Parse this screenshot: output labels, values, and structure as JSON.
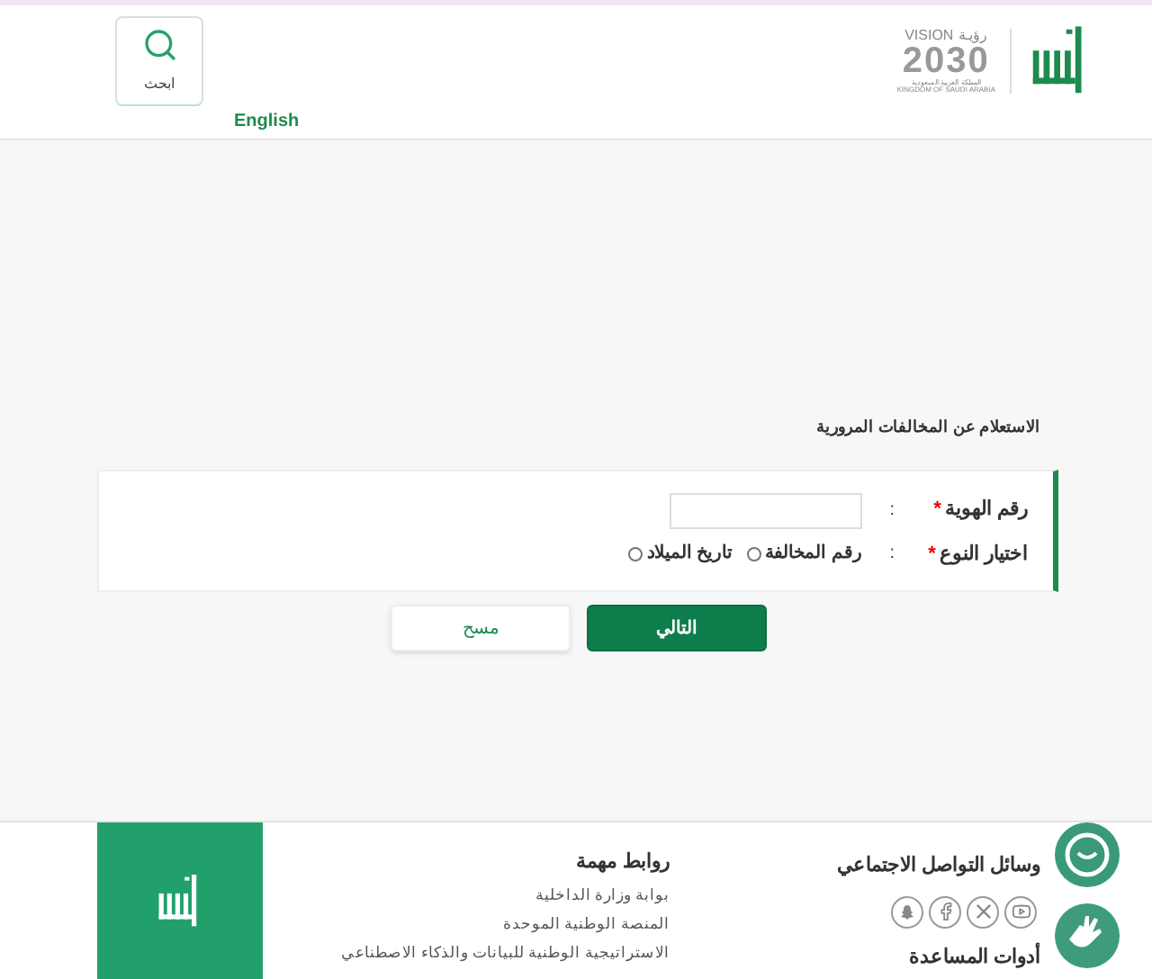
{
  "header": {
    "search_button": "ابحث",
    "language_link": "English",
    "vision_logo": {
      "word": "VISION",
      "arabic": "رؤيـة",
      "year": "2030",
      "country_ar": "المملكة العربية السعودية",
      "country_en": "KINGDOM OF SAUDI ARABIA"
    }
  },
  "page_title": "الاستعلام عن المخالفات المرورية",
  "form": {
    "id_field": {
      "label": "رقم الهوية",
      "required_mark": "*",
      "colon": ":"
    },
    "type_field": {
      "label": "اختيار النوع",
      "required_mark": "*",
      "colon": ":",
      "options": [
        {
          "label": "رقم المخالفة",
          "selected": false
        },
        {
          "label": "تاريخ الميلاد",
          "selected": false
        }
      ]
    }
  },
  "buttons": [
    {
      "kind": "primary",
      "label": "التالي"
    },
    {
      "kind": "secondary",
      "label": "مسح"
    }
  ],
  "footer": {
    "social": {
      "title": "وسائل التواصل الاجتماعي",
      "icons": [
        {
          "kind": "youtube"
        },
        {
          "kind": "x"
        },
        {
          "kind": "facebook"
        },
        {
          "kind": "snapchat"
        }
      ]
    },
    "assist_title": "أدوات المساعدة",
    "links": {
      "title": "روابط مهمة",
      "items": [
        "بوابة وزارة الداخلية",
        "المنصة الوطنية الموحدة",
        "الاستراتيجية الوطنية للبيانات والذكاء الاصطناعي"
      ]
    }
  }
}
